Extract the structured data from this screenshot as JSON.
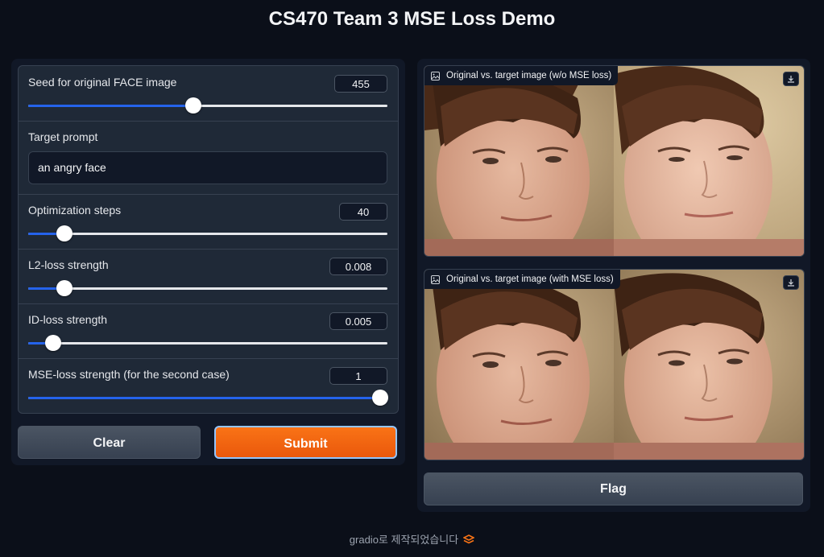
{
  "page": {
    "title": "CS470 Team 3 MSE Loss Demo"
  },
  "inputs": {
    "seed": {
      "label": "Seed for original FACE image",
      "value": "455",
      "fraction": 0.46
    },
    "prompt": {
      "label": "Target prompt",
      "value": "an angry face"
    },
    "steps": {
      "label": "Optimization steps",
      "value": "40",
      "fraction": 0.1
    },
    "l2": {
      "label": "L2-loss strength",
      "value": "0.008",
      "fraction": 0.1
    },
    "id": {
      "label": "ID-loss strength",
      "value": "0.005",
      "fraction": 0.07
    },
    "mse": {
      "label": "MSE-loss strength (for the second case)",
      "value": "1",
      "fraction": 0.98
    }
  },
  "buttons": {
    "clear": "Clear",
    "submit": "Submit",
    "flag": "Flag"
  },
  "outputs": {
    "first": {
      "label": "Original vs. target image (w/o MSE loss)"
    },
    "second": {
      "label": "Original vs. target image (with MSE loss)"
    }
  },
  "footer": {
    "text": "gradio로 제작되었습니다"
  },
  "colors": {
    "accent": "#2563eb",
    "submit": "#f97316",
    "background": "#0b0f19"
  },
  "icons": {
    "image_label": "image-icon",
    "download": "download-icon",
    "gradio_logo": "gradio-logo-icon"
  }
}
